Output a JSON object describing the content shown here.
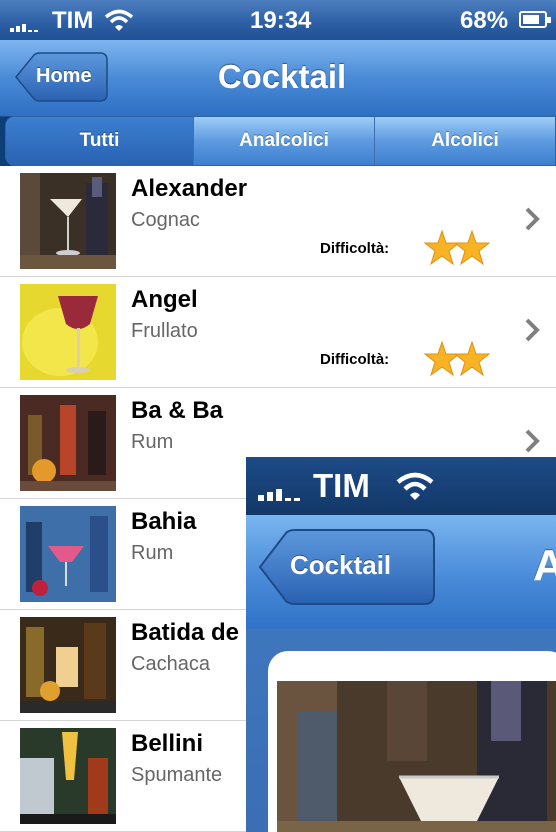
{
  "status_bar": {
    "carrier": "TIM",
    "time": "19:34",
    "battery": "68%"
  },
  "nav": {
    "back_label": "Home",
    "title": "Cocktail"
  },
  "segments": [
    {
      "label": "Tutti",
      "selected": true
    },
    {
      "label": "Analcolici",
      "selected": false
    },
    {
      "label": "Alcolici",
      "selected": false
    }
  ],
  "cocktails": [
    {
      "name": "Alexander",
      "base": "Cognac",
      "difficulty_label": "Difficoltà:",
      "difficulty_stars": 2
    },
    {
      "name": "Angel",
      "base": "Frullato",
      "difficulty_label": "Difficoltà:",
      "difficulty_stars": 2
    },
    {
      "name": "Ba & Ba",
      "base": "Rum"
    },
    {
      "name": "Bahia",
      "base": "Rum"
    },
    {
      "name": "Batida de",
      "base": "Cachaca"
    },
    {
      "name": "Bellini",
      "base": "Spumante"
    }
  ],
  "detail_overlay": {
    "status_carrier": "TIM",
    "back_label": "Cocktail",
    "title_partial": "A"
  },
  "colors": {
    "nav_blue": "#4a8ad6",
    "star": "#f7b324",
    "chevron": "#7f7f7f"
  }
}
